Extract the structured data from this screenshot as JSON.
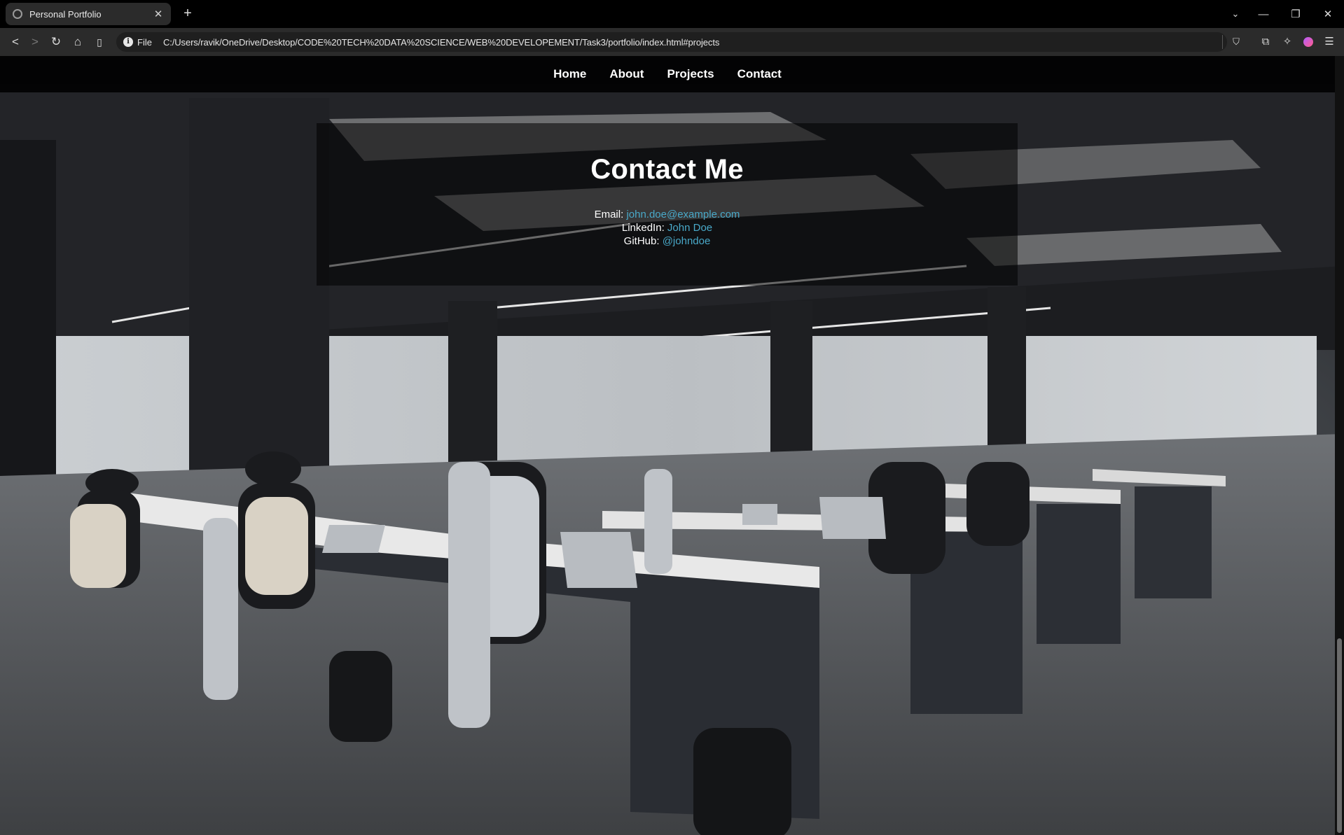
{
  "browser": {
    "tab_title": "Personal Portfolio",
    "tab_close": "✕",
    "new_tab": "+",
    "url_scheme": "File",
    "url": "C:/Users/ravik/OneDrive/Desktop/CODE%20TECH%20DATA%20SCIENCE/WEB%20DEVELOPEMENT/Task3/portfolio/index.html#projects",
    "icons": [
      "back-icon",
      "forward-icon",
      "reload-icon",
      "home-icon",
      "bookmark-icon",
      "info-icon",
      "shield-icon",
      "extensions-icon",
      "ai-icon",
      "profile-icon",
      "menu-icon"
    ]
  },
  "nav": {
    "items": [
      {
        "label": "Home"
      },
      {
        "label": "About"
      },
      {
        "label": "Projects"
      },
      {
        "label": "Contact"
      }
    ]
  },
  "contact": {
    "title": "Contact Me",
    "email_label": "Email:",
    "email_value": "john.doe@example.com",
    "linkedin_label": "LinkedIn:",
    "linkedin_value": "John Doe",
    "github_label": "GitHub:",
    "github_value": "@johndoe"
  },
  "colors": {
    "link": "#49a9c9",
    "nav_bg": "#000000",
    "chrome_bg": "#2b2b2b"
  }
}
